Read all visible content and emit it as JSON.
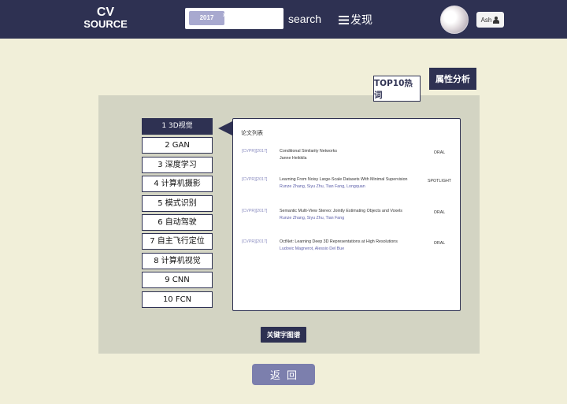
{
  "logo": {
    "line1": "CV",
    "line2": "SOURCE"
  },
  "search": {
    "tag": "2017",
    "tag_close": "x",
    "label": "search"
  },
  "nav": {
    "discover_label": "发现"
  },
  "user": {
    "name": "Ash"
  },
  "buttons": {
    "attr_analysis": "属性分析",
    "top10": "TOP10热词",
    "keyword_graph": "关键字图谱",
    "back": "返回"
  },
  "categories": [
    "1 3D视觉",
    "2 GAN",
    "3 深度学习",
    "4 计算机摄影",
    "5 模式识别",
    "6 自动驾驶",
    "7 自主飞行定位",
    "8 计算机视觉",
    "9 CNN",
    "10 FCN"
  ],
  "paper_list": {
    "title": "论文列表",
    "papers": [
      {
        "venue": "[CVPR][2017]",
        "title": "Conditional Similarity Networks",
        "authors": "Janne Heikkila",
        "type": "ORAL"
      },
      {
        "venue": "[CVPR][2017]",
        "title": "Learning From Noisy Large-Scale Datasets With Minimal Supervision",
        "authors": "Runze Zhang, Siyu Zhu, Tian Fang, Longquan",
        "type": "SPOTLIGHT"
      },
      {
        "venue": "[CVPR][2017]",
        "title": "Semantic Multi-View Stereo: Jointly Estimating Objects and Voxels",
        "authors": "Runze Zhang, Siyu Zhu, Tian Fang",
        "type": "ORAL"
      },
      {
        "venue": "[CVPR][2017]",
        "title": "OctNet: Learning Deep 3D Representations at High Resolutions",
        "authors": "Ludovic Magnerot, Alessio Del Bue",
        "type": "ORAL"
      }
    ]
  },
  "colors": {
    "nav_bg": "#2e3152",
    "page_bg": "#f1efd9",
    "panel_bg": "#d3d4c3",
    "back_btn": "#7c7fad",
    "tag_bg": "#a8a9cf"
  }
}
